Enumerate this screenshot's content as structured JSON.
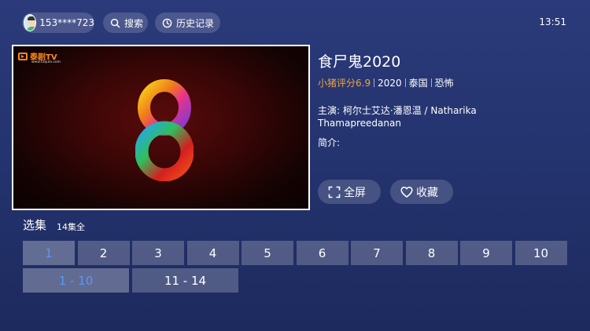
{
  "header": {
    "user": {
      "phone": "153****723"
    },
    "search_label": "搜索",
    "history_label": "历史记录",
    "clock": "13:51"
  },
  "poster": {
    "logo_text": "泰剧TV",
    "logo_url_text": "www.taijutv.com"
  },
  "detail": {
    "title": "食尸鬼2020",
    "score": "小猪评分6.9",
    "year": "2020",
    "country": "泰国",
    "genre": "恐怖",
    "cast_label": "主演:",
    "cast": "柯尔士艾达·潘恩温 / Natharika Thamapreedanan",
    "intro_label": "简介:"
  },
  "actions": {
    "fullscreen_label": "全屏",
    "favorite_label": "收藏"
  },
  "episodes": {
    "heading": "选集",
    "total": "14集全",
    "items": [
      "1",
      "2",
      "3",
      "4",
      "5",
      "6",
      "7",
      "8",
      "9",
      "10"
    ],
    "selected": "1",
    "ranges": [
      "1 - 10",
      "11 - 14"
    ],
    "selected_range": "1 - 10"
  },
  "colors": {
    "accent": "#5b95ff",
    "score": "#f2a43a",
    "background": "#24346f"
  }
}
